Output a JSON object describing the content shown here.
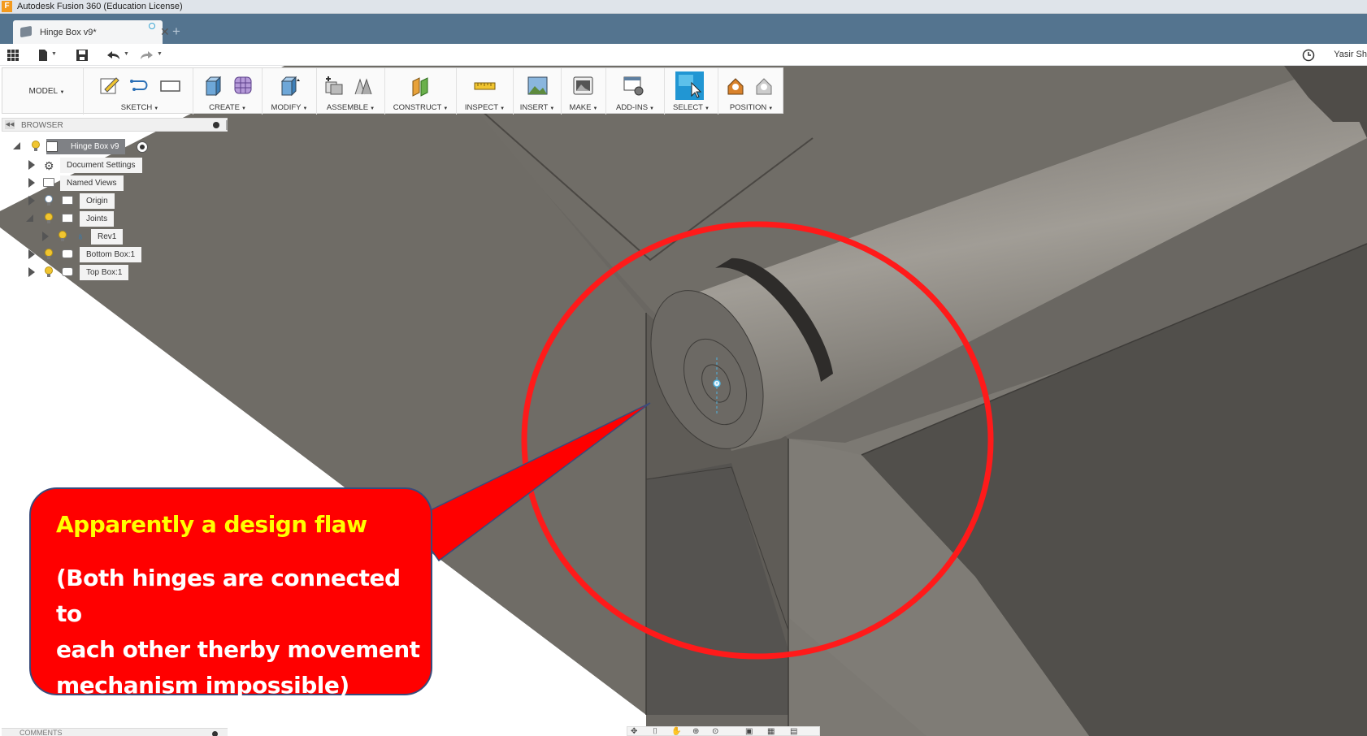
{
  "window": {
    "title": "Autodesk Fusion 360 (Education License)",
    "app_icon_letter": "F"
  },
  "tabs": [
    {
      "label": "Hinge Box v9*"
    }
  ],
  "quick_access": {
    "user_name": "Yasir Sh"
  },
  "toolbar": {
    "workspace": "MODEL",
    "groups": [
      {
        "label": "SKETCH"
      },
      {
        "label": "CREATE"
      },
      {
        "label": "MODIFY"
      },
      {
        "label": "ASSEMBLE"
      },
      {
        "label": "CONSTRUCT"
      },
      {
        "label": "INSPECT"
      },
      {
        "label": "INSERT"
      },
      {
        "label": "MAKE"
      },
      {
        "label": "ADD-INS"
      },
      {
        "label": "SELECT"
      },
      {
        "label": "POSITION"
      }
    ]
  },
  "browser": {
    "title": "BROWSER",
    "root": "Hinge Box v9",
    "items": [
      {
        "label": "Document Settings"
      },
      {
        "label": "Named Views"
      },
      {
        "label": "Origin"
      },
      {
        "label": "Joints"
      },
      {
        "label": "Rev1"
      },
      {
        "label": "Bottom Box:1"
      },
      {
        "label": "Top Box:1"
      }
    ]
  },
  "comments": {
    "title": "COMMENTS"
  },
  "callout": {
    "title": "Apparently a design flaw",
    "body_lines": [
      "(Both hinges are connected to",
      "each other therby movement",
      "mechanism impossible)"
    ]
  },
  "colors": {
    "tab_strip": "#54748f",
    "callout_fill": "#ff0000",
    "callout_title": "#ffff00",
    "highlight_circle": "#ff1a1a",
    "model_dark": "#5d5a55",
    "model_light": "#8a8680",
    "select_active": "#2196d3"
  }
}
